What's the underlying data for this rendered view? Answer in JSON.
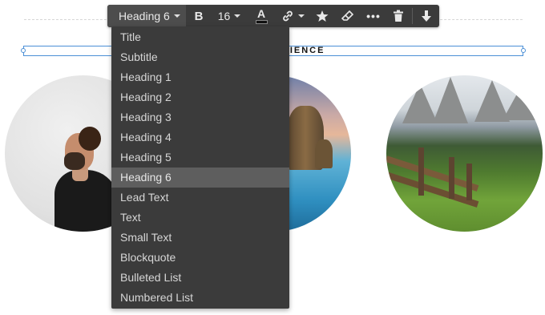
{
  "toolbar": {
    "style_label": "Heading 6",
    "bold_label": "B",
    "font_size": "16",
    "text_color_label": "A",
    "more_label": "•••",
    "icons": [
      "link-icon",
      "star-icon",
      "eraser-icon",
      "trash-icon",
      "arrow-down-icon"
    ]
  },
  "heading": {
    "text": "ERIENCE"
  },
  "dropdown": {
    "items": [
      {
        "label": "Title"
      },
      {
        "label": "Subtitle"
      },
      {
        "label": "Heading 1"
      },
      {
        "label": "Heading 2"
      },
      {
        "label": "Heading 3"
      },
      {
        "label": "Heading 4"
      },
      {
        "label": "Heading 5"
      },
      {
        "label": "Heading 6"
      },
      {
        "label": "Lead Text"
      },
      {
        "label": "Text"
      },
      {
        "label": "Small Text"
      },
      {
        "label": "Blockquote"
      },
      {
        "label": "Bulleted List"
      },
      {
        "label": "Numbered List"
      }
    ],
    "selected": "Heading 6"
  },
  "colors": {
    "toolbar_bg": "#3b3b3b",
    "selected_bg": "#5e5e5e",
    "frame_border": "#4b8fd6"
  }
}
